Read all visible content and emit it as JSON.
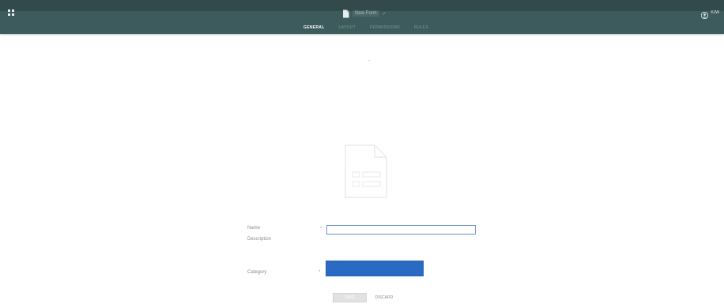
{
  "header": {
    "background_color": "#3d5b5c",
    "apps_icon": "apps-grid-icon",
    "document": {
      "icon": "document-icon",
      "name": "New Form"
    },
    "tabs": [
      {
        "label": "GENERAL",
        "active": true
      },
      {
        "label": "LAYOUT",
        "active": false
      },
      {
        "label": "PERMISSIONS",
        "active": false
      },
      {
        "label": "RULES",
        "active": false
      }
    ],
    "user": {
      "icon": "user-circle-icon",
      "name": "KJW"
    }
  },
  "main": {
    "placeholder_icon": "form-document-icon",
    "form": {
      "name_label": "Name",
      "name_required": "*",
      "name_value": "",
      "description_label": "Description",
      "category_label": "Category",
      "category_required": "*",
      "category_value": "",
      "category_color": "#2a6ac2"
    },
    "buttons": {
      "save_label": "SAVE",
      "discard_label": "DISCARD"
    }
  }
}
